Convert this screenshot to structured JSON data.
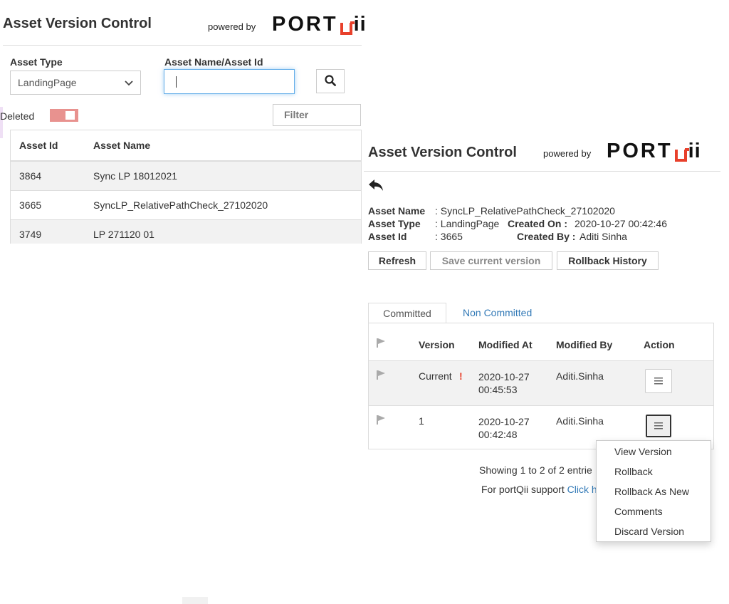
{
  "left": {
    "title": "Asset Version Control",
    "powered_by": "powered by",
    "logo": {
      "port": "PORT",
      "ii": "ii"
    },
    "asset_type_label": "Asset Type",
    "asset_type_value": "LandingPage",
    "asset_name_label": "Asset Name/Asset Id",
    "asset_name_value": "",
    "deleted_label": "Deleted",
    "filter_placeholder": "Filter",
    "table": {
      "headers": [
        "Asset Id",
        "Asset Name"
      ],
      "rows": [
        {
          "id": "3864",
          "name": "Sync LP 18012021"
        },
        {
          "id": "3665",
          "name": "SyncLP_RelativePathCheck_27102020"
        },
        {
          "id": "3749",
          "name": "LP 271120 01"
        }
      ]
    }
  },
  "right": {
    "title": "Asset Version Control",
    "powered_by": "powered by",
    "logo": {
      "port": "PORT",
      "ii": "ii"
    },
    "details": {
      "asset_name_label": "Asset Name",
      "asset_name_value": ": SyncLP_RelativePathCheck_27102020",
      "asset_type_label": "Asset Type",
      "asset_type_value": ": LandingPage",
      "created_on_label": "Created On :",
      "created_on_value": "2020-10-27 00:42:46",
      "asset_id_label": "Asset Id",
      "asset_id_value": ": 3665",
      "created_by_label": "Created By :",
      "created_by_value": "Aditi Sinha"
    },
    "buttons": {
      "refresh": "Refresh",
      "save": "Save current version",
      "rollback_history": "Rollback History"
    },
    "tabs": [
      "Committed",
      "Non Committed"
    ],
    "versions": {
      "headers": [
        "Version",
        "Modified At",
        "Modified By",
        "Action"
      ],
      "rows": [
        {
          "version": "Current",
          "alert": "!",
          "modified_at_1": "2020-10-27",
          "modified_at_2": "00:45:53",
          "modified_by": "Aditi.Sinha"
        },
        {
          "version": "1",
          "alert": "",
          "modified_at_1": "2020-10-27",
          "modified_at_2": "00:42:48",
          "modified_by": "Aditi.Sinha"
        }
      ]
    },
    "showing": "Showing 1 to 2 of 2 entrie",
    "support_text": "For portQii support",
    "support_link": "Click he",
    "menu": [
      "View Version",
      "Rollback",
      "Rollback As New",
      "Comments",
      "Discard Version"
    ]
  },
  "colors": {
    "accent_red": "#e8402b",
    "link_blue": "#337ab7",
    "toggle_pink": "#e8928f",
    "row_alt": "#f2f2f2"
  }
}
